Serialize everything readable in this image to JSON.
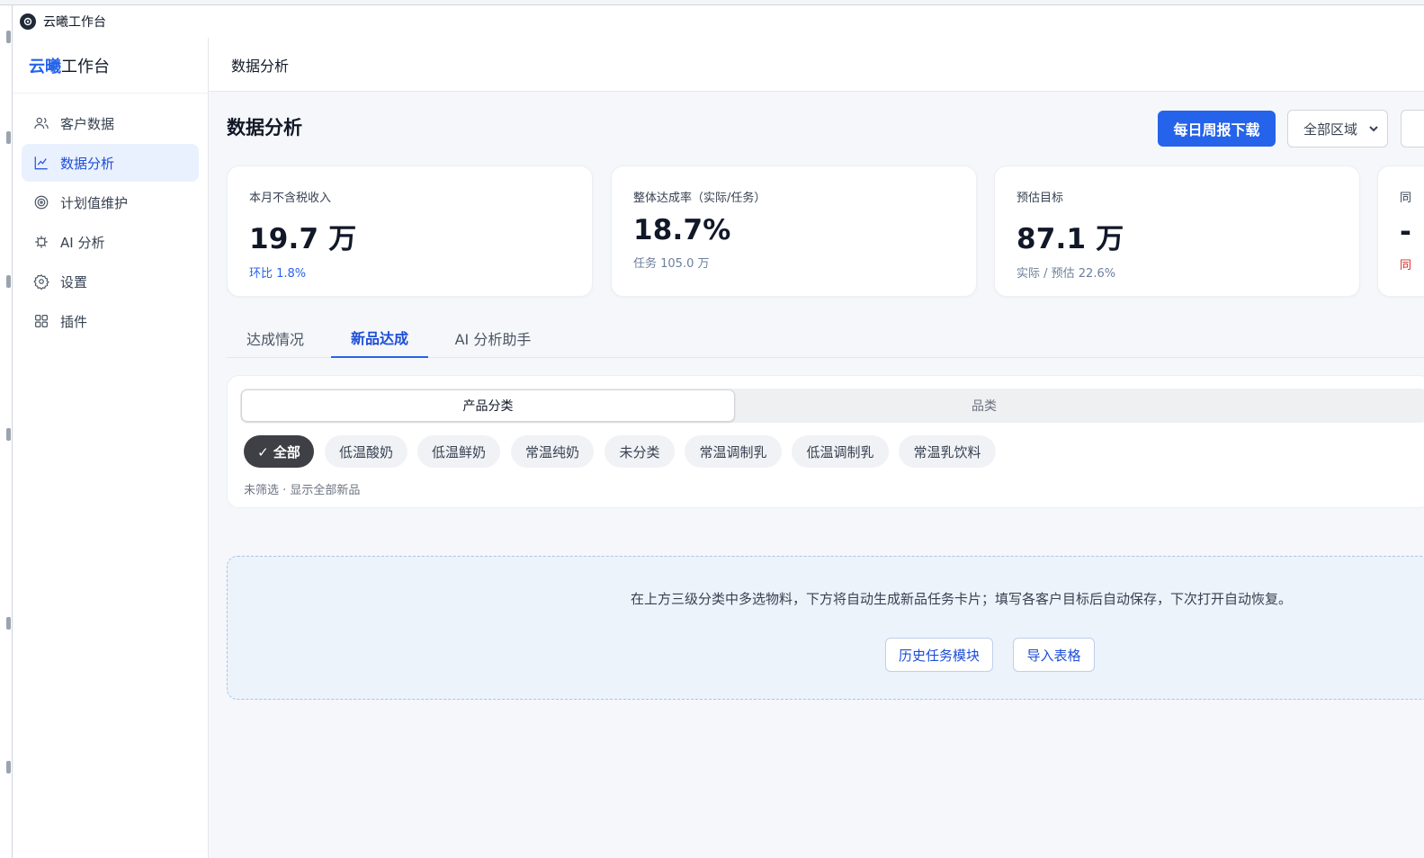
{
  "window": {
    "title": "云曦工作台"
  },
  "sidebar": {
    "brand_accent": "云曦",
    "brand_rest": "工作台",
    "items": [
      {
        "label": "客户数据",
        "icon": "users-icon"
      },
      {
        "label": "数据分析",
        "icon": "chart-line-icon",
        "active": true
      },
      {
        "label": "计划值维护",
        "icon": "target-icon"
      },
      {
        "label": "AI 分析",
        "icon": "chip-icon"
      },
      {
        "label": "设置",
        "icon": "gear-icon"
      },
      {
        "label": "插件",
        "icon": "grid-icon"
      }
    ]
  },
  "topbar": {
    "title": "数据分析"
  },
  "header": {
    "title": "数据分析",
    "download_button": "每日周报下载",
    "region_select": "全部区域"
  },
  "stats": [
    {
      "label": "本月不含税收入",
      "value": "19.7 万",
      "sub": "环比 1.8%",
      "sub_color": "#2563eb"
    },
    {
      "label": "整体达成率（实际/任务）",
      "value": "18.7%",
      "sub": "任务 105.0 万",
      "sub_color": "#6b7f99"
    },
    {
      "label": "预估目标",
      "value": "87.1 万",
      "sub": "实际 / 预估 22.6%",
      "sub_color": "#6b7f99"
    },
    {
      "label": "同",
      "value": "-",
      "sub": "同",
      "sub_color": "#dc2626"
    }
  ],
  "tabs": [
    {
      "label": "达成情况"
    },
    {
      "label": "新品达成",
      "active": true
    },
    {
      "label": "AI 分析助手"
    }
  ],
  "filter": {
    "segments": [
      {
        "label": "产品分类",
        "active": true
      },
      {
        "label": "品类"
      }
    ],
    "chips": [
      {
        "label": "✓ 全部",
        "active": true
      },
      {
        "label": "低温酸奶"
      },
      {
        "label": "低温鲜奶"
      },
      {
        "label": "常温纯奶"
      },
      {
        "label": "未分类"
      },
      {
        "label": "常温调制乳"
      },
      {
        "label": "低温调制乳"
      },
      {
        "label": "常温乳饮料"
      }
    ],
    "hint": "未筛选 · 显示全部新品"
  },
  "empty_panel": {
    "message": "在上方三级分类中多选物料，下方将自动生成新品任务卡片；填写各客户目标后自动保存，下次打开自动恢复。",
    "history_button": "历史任务模块",
    "import_button": "导入表格"
  },
  "colors": {
    "accent": "#2563eb",
    "active_nav_bg": "#eaf1fe",
    "page_bg": "#f5f7fa",
    "chip_active_bg": "#3f3f46",
    "danger": "#dc2626"
  }
}
